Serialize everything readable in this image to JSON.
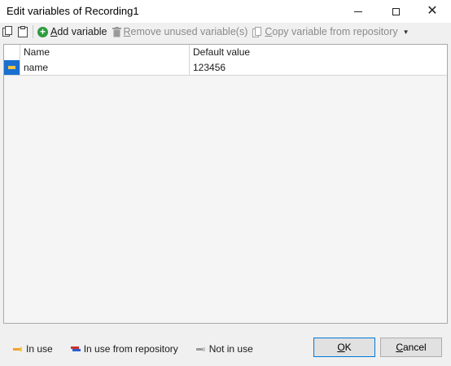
{
  "window": {
    "title": "Edit variables of Recording1"
  },
  "toolbar": {
    "add_label": "Add variable",
    "add_mnemonic": "A",
    "add_rest": "dd variable",
    "remove_label": "Remove unused variable(s)",
    "remove_mnemonic": "R",
    "remove_rest": "emove unused variable(s)",
    "copy_label": "Copy variable from repository",
    "copy_mnemonic": "C",
    "copy_rest": "opy variable from repository"
  },
  "grid": {
    "columns": [
      "Name",
      "Default value"
    ],
    "rows": [
      {
        "name": "name",
        "default_value": "123456"
      }
    ]
  },
  "legend": [
    {
      "label": "In use",
      "colors": [
        "#f0a030",
        "#f5c542"
      ]
    },
    {
      "label": "In use from repository",
      "colors": [
        "#d0302a",
        "#2a5fd0"
      ]
    },
    {
      "label": "Not in use",
      "colors": [
        "#9a9a9a",
        "#c8c8c8"
      ]
    }
  ],
  "buttons": {
    "ok_mnemonic": "O",
    "ok_rest": "K",
    "cancel_mnemonic": "C",
    "cancel_rest": "ancel"
  },
  "colors": {
    "row_indicator": "#1a6fd1",
    "add_icon": "#2e9b3f",
    "disabled_text": "#8a8a8a"
  }
}
